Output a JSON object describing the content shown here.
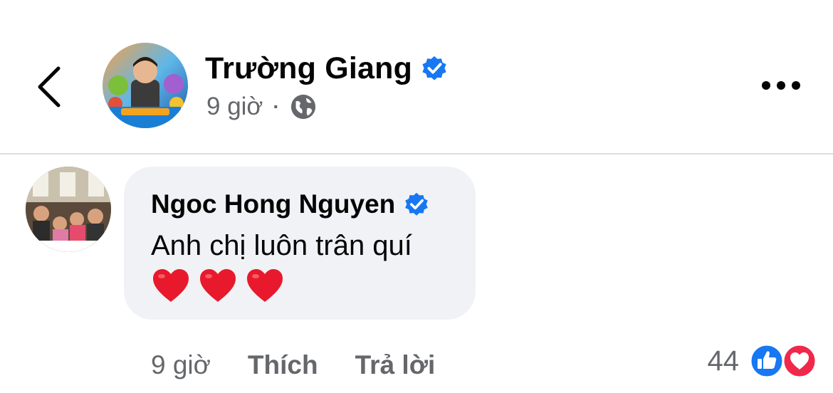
{
  "post": {
    "author_name": "Trường Giang",
    "time": "9 giờ",
    "separator": "·",
    "verified_icon": "verified-badge-icon",
    "privacy_icon": "globe-icon"
  },
  "header": {
    "back_icon": "chevron-left-icon",
    "more_icon": "more-dots-icon"
  },
  "comment": {
    "author_name": "Ngoc Hong Nguyen",
    "text": "Anh chị luôn trân quí",
    "emoji": [
      "heart",
      "heart",
      "heart"
    ],
    "time": "9 giờ",
    "like_label": "Thích",
    "reply_label": "Trả lời",
    "reaction_count": "44",
    "reactions": [
      "like",
      "love"
    ]
  },
  "colors": {
    "verified_blue": "#1877f2",
    "secondary_text": "#65676b",
    "bubble_bg": "#f0f2f5",
    "love_red": "#f0284a"
  }
}
